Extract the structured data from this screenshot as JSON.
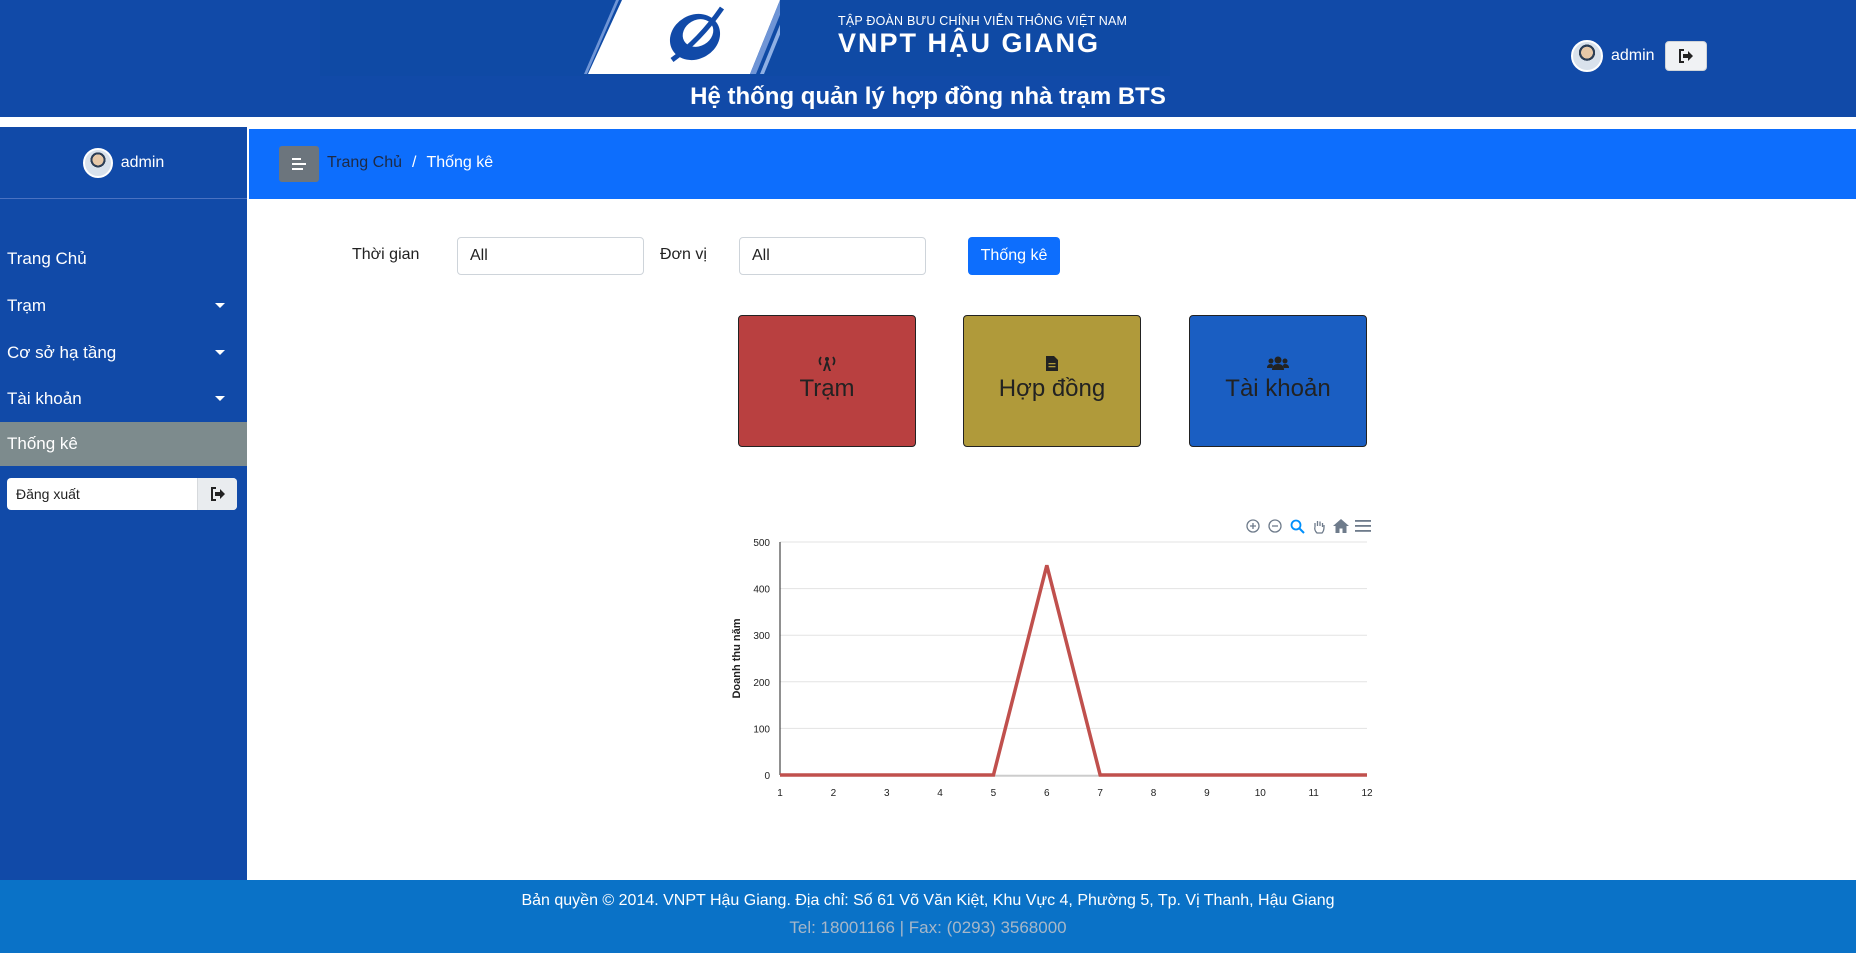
{
  "header": {
    "org_line": "TẬP ĐOÀN BƯU CHÍNH VIỄN THÔNG VIỆT NAM",
    "brand": "VNPT HẬU GIANG",
    "system_title": "Hệ thống quản lý hợp đồng nhà trạm BTS",
    "user_name": "admin"
  },
  "sidebar": {
    "user_name": "admin",
    "items": [
      {
        "label": "Trang Chủ"
      },
      {
        "label": "Trạm"
      },
      {
        "label": "Cơ sở hạ tầng"
      },
      {
        "label": "Tài khoản"
      },
      {
        "label": "Thống kê"
      }
    ],
    "logout_label": "Đăng xuất"
  },
  "breadcrumb": {
    "home": "Trang Chủ",
    "separator": "/",
    "current": "Thống kê"
  },
  "filters": {
    "time_label": "Thời gian",
    "time_value": "All",
    "unit_label": "Đơn vị",
    "unit_value": "All",
    "submit_label": "Thống kê"
  },
  "cards": [
    {
      "label": "Trạm",
      "color": "#b94040",
      "icon": "broadcast-tower-icon"
    },
    {
      "label": "Hợp đồng",
      "color": "#b09a3a",
      "icon": "file-icon"
    },
    {
      "label": "Tài khoản",
      "color": "#1a5ec2",
      "icon": "users-icon"
    }
  ],
  "chart_data": {
    "type": "line",
    "x": [
      1,
      2,
      3,
      4,
      5,
      6,
      7,
      8,
      9,
      10,
      11,
      12
    ],
    "series": [
      {
        "values": [
          0,
          0,
          0,
          0,
          0,
          450,
          0,
          0,
          0,
          0,
          0,
          0
        ],
        "color": "#c0504d"
      }
    ],
    "xlabel": "",
    "ylabel": "Doanh thu năm",
    "ylim": [
      0,
      500
    ],
    "yticks": [
      0,
      100,
      200,
      300,
      400,
      500
    ],
    "grid": true
  },
  "footer": {
    "line1": "Bản quyền © 2014. VNPT Hậu Giang. Địa chỉ: Số 61 Võ Văn Kiệt, Khu Vực 4, Phường 5, Tp. Vị Thanh, Hậu Giang",
    "line2": "Tel: 18001166 | Fax: (0293) 3568000"
  }
}
